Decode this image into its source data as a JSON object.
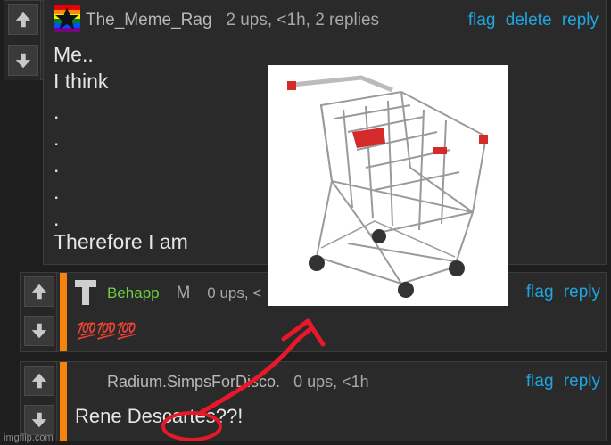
{
  "comments": [
    {
      "username": "The_Meme_Rag",
      "stats": "2 ups, <1h, 2 replies",
      "actions": [
        "flag",
        "delete",
        "reply"
      ],
      "lines": [
        "Me..",
        "I think",
        ".",
        ".",
        ".",
        ".",
        ".",
        "Therefore I am"
      ]
    },
    {
      "username": "Behapp",
      "badge": "M",
      "stats": "0 ups, <",
      "actions": [
        "flag",
        "reply"
      ],
      "body": "💯💯💯"
    },
    {
      "username": "Radium.SimpsForDisco.",
      "stats": "0 ups, <1h",
      "actions": [
        "flag",
        "reply"
      ],
      "body": "Rene Descartes??!"
    }
  ],
  "watermark": "imgflip.com",
  "colors": {
    "accent_bar": "#f5830e",
    "link": "#1fa6e0",
    "username_green": "#6dcf3e",
    "annotation": "#e8182b"
  }
}
